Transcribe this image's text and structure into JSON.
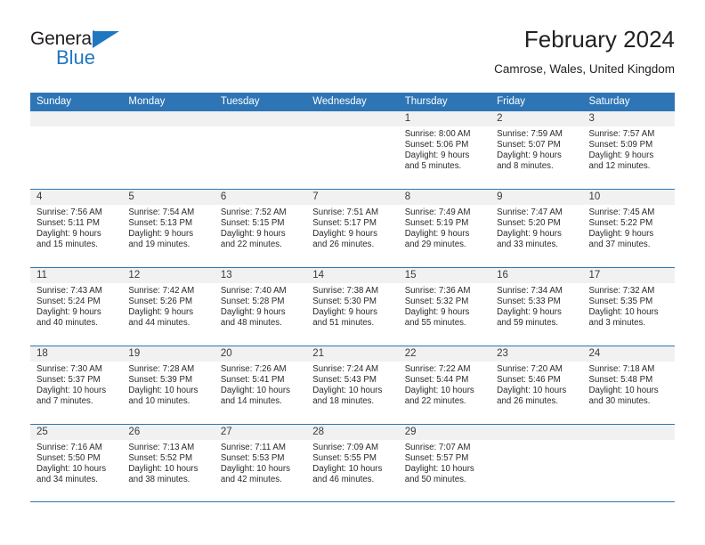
{
  "brand": {
    "name_part1": "General",
    "name_part2": "Blue",
    "triangle_icon": "blue-triangle-icon",
    "color_primary": "#1f77c2",
    "color_text": "#231f20"
  },
  "header": {
    "title": "February 2024",
    "subtitle": "Camrose, Wales, United Kingdom"
  },
  "theme": {
    "header_blue": "#2e75b6",
    "day_band_gray": "#f1f1f1",
    "text": "#2a2a2a"
  },
  "weekdays": [
    "Sunday",
    "Monday",
    "Tuesday",
    "Wednesday",
    "Thursday",
    "Friday",
    "Saturday"
  ],
  "labels": {
    "sunrise": "Sunrise:",
    "sunset": "Sunset:",
    "daylight": "Daylight:"
  },
  "weeks": [
    [
      {
        "day": "",
        "sunrise": "",
        "sunset": "",
        "daylight": ""
      },
      {
        "day": "",
        "sunrise": "",
        "sunset": "",
        "daylight": ""
      },
      {
        "day": "",
        "sunrise": "",
        "sunset": "",
        "daylight": ""
      },
      {
        "day": "",
        "sunrise": "",
        "sunset": "",
        "daylight": ""
      },
      {
        "day": "1",
        "sunrise": "Sunrise: 8:00 AM",
        "sunset": "Sunset: 5:06 PM",
        "daylight": "Daylight: 9 hours and 5 minutes."
      },
      {
        "day": "2",
        "sunrise": "Sunrise: 7:59 AM",
        "sunset": "Sunset: 5:07 PM",
        "daylight": "Daylight: 9 hours and 8 minutes."
      },
      {
        "day": "3",
        "sunrise": "Sunrise: 7:57 AM",
        "sunset": "Sunset: 5:09 PM",
        "daylight": "Daylight: 9 hours and 12 minutes."
      }
    ],
    [
      {
        "day": "4",
        "sunrise": "Sunrise: 7:56 AM",
        "sunset": "Sunset: 5:11 PM",
        "daylight": "Daylight: 9 hours and 15 minutes."
      },
      {
        "day": "5",
        "sunrise": "Sunrise: 7:54 AM",
        "sunset": "Sunset: 5:13 PM",
        "daylight": "Daylight: 9 hours and 19 minutes."
      },
      {
        "day": "6",
        "sunrise": "Sunrise: 7:52 AM",
        "sunset": "Sunset: 5:15 PM",
        "daylight": "Daylight: 9 hours and 22 minutes."
      },
      {
        "day": "7",
        "sunrise": "Sunrise: 7:51 AM",
        "sunset": "Sunset: 5:17 PM",
        "daylight": "Daylight: 9 hours and 26 minutes."
      },
      {
        "day": "8",
        "sunrise": "Sunrise: 7:49 AM",
        "sunset": "Sunset: 5:19 PM",
        "daylight": "Daylight: 9 hours and 29 minutes."
      },
      {
        "day": "9",
        "sunrise": "Sunrise: 7:47 AM",
        "sunset": "Sunset: 5:20 PM",
        "daylight": "Daylight: 9 hours and 33 minutes."
      },
      {
        "day": "10",
        "sunrise": "Sunrise: 7:45 AM",
        "sunset": "Sunset: 5:22 PM",
        "daylight": "Daylight: 9 hours and 37 minutes."
      }
    ],
    [
      {
        "day": "11",
        "sunrise": "Sunrise: 7:43 AM",
        "sunset": "Sunset: 5:24 PM",
        "daylight": "Daylight: 9 hours and 40 minutes."
      },
      {
        "day": "12",
        "sunrise": "Sunrise: 7:42 AM",
        "sunset": "Sunset: 5:26 PM",
        "daylight": "Daylight: 9 hours and 44 minutes."
      },
      {
        "day": "13",
        "sunrise": "Sunrise: 7:40 AM",
        "sunset": "Sunset: 5:28 PM",
        "daylight": "Daylight: 9 hours and 48 minutes."
      },
      {
        "day": "14",
        "sunrise": "Sunrise: 7:38 AM",
        "sunset": "Sunset: 5:30 PM",
        "daylight": "Daylight: 9 hours and 51 minutes."
      },
      {
        "day": "15",
        "sunrise": "Sunrise: 7:36 AM",
        "sunset": "Sunset: 5:32 PM",
        "daylight": "Daylight: 9 hours and 55 minutes."
      },
      {
        "day": "16",
        "sunrise": "Sunrise: 7:34 AM",
        "sunset": "Sunset: 5:33 PM",
        "daylight": "Daylight: 9 hours and 59 minutes."
      },
      {
        "day": "17",
        "sunrise": "Sunrise: 7:32 AM",
        "sunset": "Sunset: 5:35 PM",
        "daylight": "Daylight: 10 hours and 3 minutes."
      }
    ],
    [
      {
        "day": "18",
        "sunrise": "Sunrise: 7:30 AM",
        "sunset": "Sunset: 5:37 PM",
        "daylight": "Daylight: 10 hours and 7 minutes."
      },
      {
        "day": "19",
        "sunrise": "Sunrise: 7:28 AM",
        "sunset": "Sunset: 5:39 PM",
        "daylight": "Daylight: 10 hours and 10 minutes."
      },
      {
        "day": "20",
        "sunrise": "Sunrise: 7:26 AM",
        "sunset": "Sunset: 5:41 PM",
        "daylight": "Daylight: 10 hours and 14 minutes."
      },
      {
        "day": "21",
        "sunrise": "Sunrise: 7:24 AM",
        "sunset": "Sunset: 5:43 PM",
        "daylight": "Daylight: 10 hours and 18 minutes."
      },
      {
        "day": "22",
        "sunrise": "Sunrise: 7:22 AM",
        "sunset": "Sunset: 5:44 PM",
        "daylight": "Daylight: 10 hours and 22 minutes."
      },
      {
        "day": "23",
        "sunrise": "Sunrise: 7:20 AM",
        "sunset": "Sunset: 5:46 PM",
        "daylight": "Daylight: 10 hours and 26 minutes."
      },
      {
        "day": "24",
        "sunrise": "Sunrise: 7:18 AM",
        "sunset": "Sunset: 5:48 PM",
        "daylight": "Daylight: 10 hours and 30 minutes."
      }
    ],
    [
      {
        "day": "25",
        "sunrise": "Sunrise: 7:16 AM",
        "sunset": "Sunset: 5:50 PM",
        "daylight": "Daylight: 10 hours and 34 minutes."
      },
      {
        "day": "26",
        "sunrise": "Sunrise: 7:13 AM",
        "sunset": "Sunset: 5:52 PM",
        "daylight": "Daylight: 10 hours and 38 minutes."
      },
      {
        "day": "27",
        "sunrise": "Sunrise: 7:11 AM",
        "sunset": "Sunset: 5:53 PM",
        "daylight": "Daylight: 10 hours and 42 minutes."
      },
      {
        "day": "28",
        "sunrise": "Sunrise: 7:09 AM",
        "sunset": "Sunset: 5:55 PM",
        "daylight": "Daylight: 10 hours and 46 minutes."
      },
      {
        "day": "29",
        "sunrise": "Sunrise: 7:07 AM",
        "sunset": "Sunset: 5:57 PM",
        "daylight": "Daylight: 10 hours and 50 minutes."
      },
      {
        "day": "",
        "sunrise": "",
        "sunset": "",
        "daylight": ""
      },
      {
        "day": "",
        "sunrise": "",
        "sunset": "",
        "daylight": ""
      }
    ]
  ]
}
